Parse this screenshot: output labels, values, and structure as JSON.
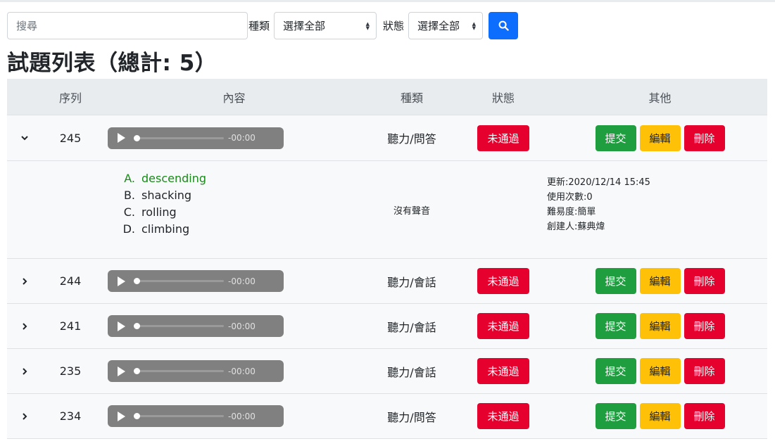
{
  "filters": {
    "search_placeholder": "搜尋",
    "type_label": "種類",
    "type_selected": "選擇全部",
    "status_label": "狀態",
    "status_selected": "選擇全部"
  },
  "page_title": "試題列表（總計: 5）",
  "table": {
    "headers": {
      "seq": "序列",
      "content": "內容",
      "type": "種類",
      "status": "狀態",
      "other": "其他"
    },
    "rows": [
      {
        "seq": "245",
        "time": "-00:00",
        "type": "聽力/問答",
        "status": "未通過",
        "submit": "提交",
        "edit": "編輯",
        "delete": "刪除"
      },
      {
        "seq": "244",
        "time": "-00:00",
        "type": "聽力/會話",
        "status": "未通過",
        "submit": "提交",
        "edit": "編輯",
        "delete": "刪除"
      },
      {
        "seq": "241",
        "time": "-00:00",
        "type": "聽力/會話",
        "status": "未通過",
        "submit": "提交",
        "edit": "編輯",
        "delete": "刪除"
      },
      {
        "seq": "235",
        "time": "-00:00",
        "type": "聽力/會話",
        "status": "未通過",
        "submit": "提交",
        "edit": "編輯",
        "delete": "刪除"
      },
      {
        "seq": "234",
        "time": "-00:00",
        "type": "聽力/問答",
        "status": "未通過",
        "submit": "提交",
        "edit": "編輯",
        "delete": "刪除"
      }
    ],
    "detail": {
      "options": [
        {
          "letter": "A.",
          "text": "descending"
        },
        {
          "letter": "B.",
          "text": "shacking"
        },
        {
          "letter": "C.",
          "text": "rolling"
        },
        {
          "letter": "D.",
          "text": "climbing"
        }
      ],
      "sound_note": "沒有聲音",
      "updated": "更新:2020/12/14 15:45",
      "usage": "使用次數:0",
      "difficulty": "難易度:簡單",
      "creator": "創建人:蘇典煒"
    }
  },
  "colors": {
    "primary": "#0d6efd",
    "danger": "#e6002e",
    "success": "#1e9e3f",
    "warning": "#ffc107",
    "correct_answer": "#1a8a1a"
  }
}
